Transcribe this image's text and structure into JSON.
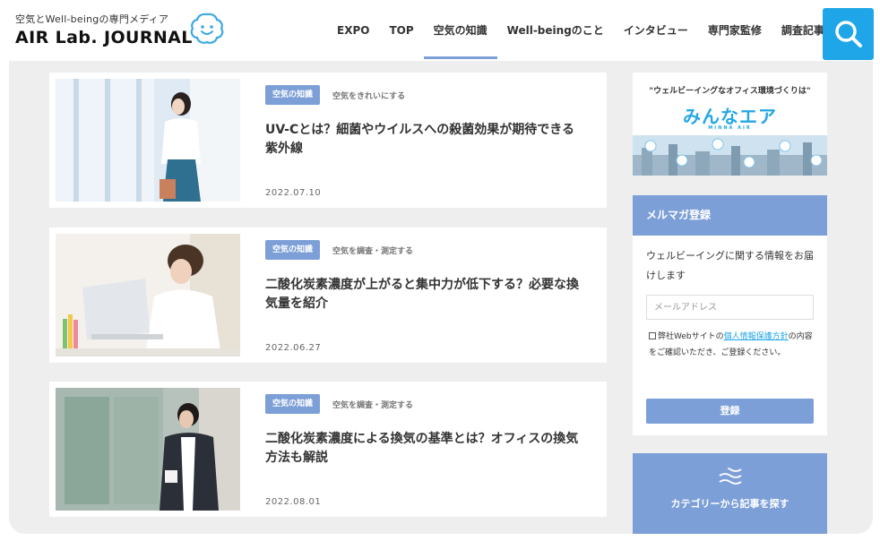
{
  "header": {
    "tagline": "空気とWell-beingの専門メディア",
    "site_title": "AIR Lab. JOURNAL",
    "nav": [
      {
        "label": "EXPO",
        "active": false
      },
      {
        "label": "TOP",
        "active": false
      },
      {
        "label": "空気の知識",
        "active": true
      },
      {
        "label": "Well-beingのこと",
        "active": false
      },
      {
        "label": "インタビュー",
        "active": false
      },
      {
        "label": "専門家監修",
        "active": false
      },
      {
        "label": "調査記事",
        "active": false
      }
    ],
    "search_icon": "search-icon"
  },
  "articles": [
    {
      "category": "空気の知識",
      "subcategory": "空気をきれいにする",
      "title": "UV-Cとは？細菌やウイルスへの殺菌効果が期待できる紫外線",
      "date": "2022.07.10"
    },
    {
      "category": "空気の知識",
      "subcategory": "空気を調査・測定する",
      "title": "二酸化炭素濃度が上がると集中力が低下する？必要な換気量を紹介",
      "date": "2022.06.27"
    },
    {
      "category": "空気の知識",
      "subcategory": "空気を調査・測定する",
      "title": "二酸化炭素濃度による換気の基準とは？オフィスの換気方法も解説",
      "date": "2022.08.01"
    }
  ],
  "sidebar": {
    "banner": {
      "text": "\"ウェルビーイングなオフィス環境づくりは\"",
      "logo": "みんなエア",
      "logo_sub": "MINNA AIR"
    },
    "newsletter": {
      "heading": "メルマガ登録",
      "description": "ウェルビーイングに関する情報をお届けします",
      "email_placeholder": "メールアドレス",
      "consent_before": "弊社Webサイトの",
      "consent_link": "個人情報保護方針",
      "consent_after": "の内容をご確認いただき、ご登録ください。",
      "submit_label": "登録"
    },
    "category": {
      "label": "カテゴリーから記事を探す",
      "icon": "waves-icon"
    }
  },
  "colors": {
    "accent": "#7d9fd8",
    "search": "#1ea6e9",
    "background": "#eeeeee"
  }
}
